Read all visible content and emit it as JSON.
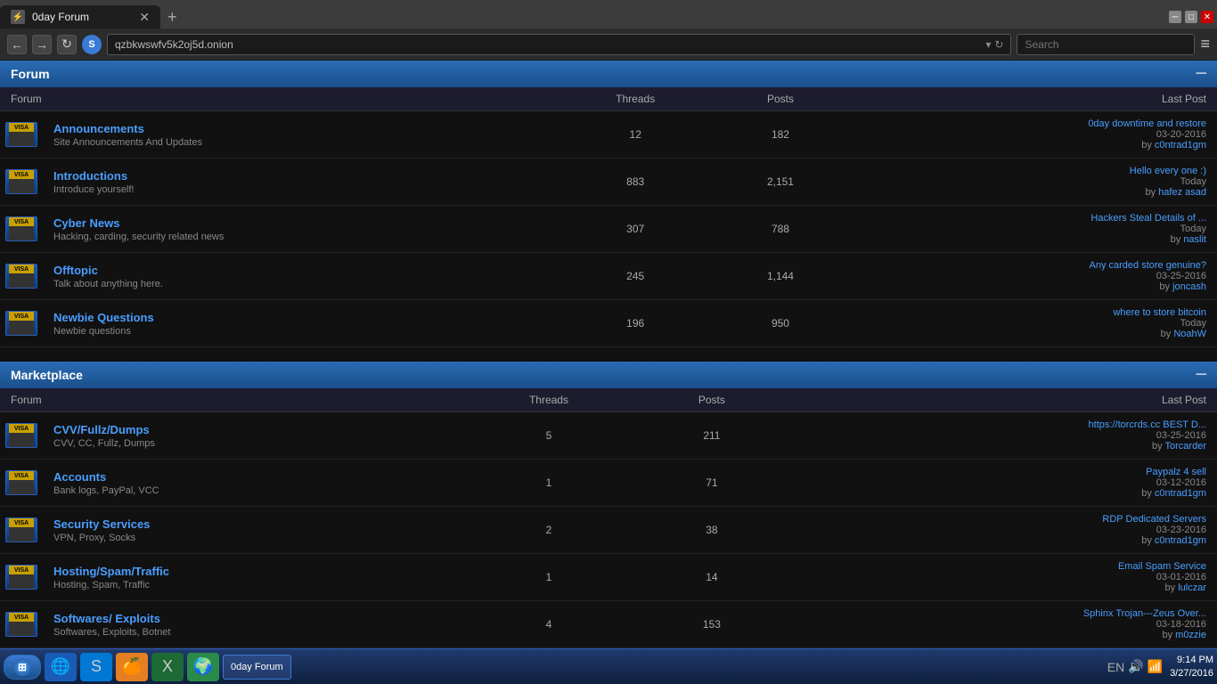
{
  "browser": {
    "tab_title": "0day Forum",
    "url": "qzbkwswfv5k2oj5d.onion",
    "search_placeholder": "Search",
    "window_controls": {
      "minimize": "─",
      "maximize": "□",
      "close": "✕"
    }
  },
  "forum_section": {
    "title": "Forum",
    "minimize_symbol": "─",
    "columns": {
      "forum": "Forum",
      "threads": "Threads",
      "posts": "Posts",
      "last_post": "Last Post"
    },
    "rows": [
      {
        "name": "Announcements",
        "desc": "Site Announcements And Updates",
        "threads": "12",
        "posts": "182",
        "last_post_title": "0day downtime and restore",
        "last_post_date": "03-20-2016",
        "last_post_by": "c0ntrad1gm"
      },
      {
        "name": "Introductions",
        "desc": "Introduce yourself!",
        "threads": "883",
        "posts": "2,151",
        "last_post_title": "Hello every one :)",
        "last_post_date": "Today",
        "last_post_by": "hafez asad"
      },
      {
        "name": "Cyber News",
        "desc": "Hacking, carding, security related news",
        "threads": "307",
        "posts": "788",
        "last_post_title": "Hackers Steal Details of ...",
        "last_post_date": "Today",
        "last_post_by": "naslit"
      },
      {
        "name": "Offtopic",
        "desc": "Talk about anything here.",
        "threads": "245",
        "posts": "1,144",
        "last_post_title": "Any carded store genuine?",
        "last_post_date": "03-25-2016",
        "last_post_by": "joncash"
      },
      {
        "name": "Newbie Questions",
        "desc": "Newbie questions",
        "threads": "196",
        "posts": "950",
        "last_post_title": "where to store bitcoin",
        "last_post_date": "Today",
        "last_post_by": "NoahW"
      }
    ]
  },
  "marketplace_section": {
    "title": "Marketplace",
    "minimize_symbol": "─",
    "columns": {
      "forum": "Forum",
      "threads": "Threads",
      "posts": "Posts",
      "last_post": "Last Post"
    },
    "rows": [
      {
        "name": "CVV/Fullz/Dumps",
        "desc": "CVV, CC, Fullz, Dumps",
        "threads": "5",
        "posts": "211",
        "last_post_title": "https://torcrds.cc BEST D...",
        "last_post_date": "03-25-2016",
        "last_post_by": "Torcarder"
      },
      {
        "name": "Accounts",
        "desc": "Bank logs, PayPal, VCC",
        "threads": "1",
        "posts": "71",
        "last_post_title": "Paypalz 4 sell",
        "last_post_date": "03-12-2016",
        "last_post_by": "c0ntrad1gm"
      },
      {
        "name": "Security Services",
        "desc": "VPN, Proxy, Socks",
        "threads": "2",
        "posts": "38",
        "last_post_title": "RDP Dedicated Servers",
        "last_post_date": "03-23-2016",
        "last_post_by": "c0ntrad1gm"
      },
      {
        "name": "Hosting/Spam/Traffic",
        "desc": "Hosting, Spam, Traffic",
        "threads": "1",
        "posts": "14",
        "last_post_title": "Email Spam Service",
        "last_post_date": "03-01-2016",
        "last_post_by": "lulczar"
      },
      {
        "name": "Softwares/ Exploits",
        "desc": "Softwares, Exploits, Botnet",
        "threads": "4",
        "posts": "153",
        "last_post_title": "Sphinx Trojan---Zeus Over...",
        "last_post_date": "03-18-2016",
        "last_post_by": "m0zzie"
      }
    ]
  },
  "taskbar": {
    "start_label": "",
    "active_window": "0day Forum",
    "time": "9:14 PM",
    "date": "3/27/2016",
    "language": "EN"
  }
}
